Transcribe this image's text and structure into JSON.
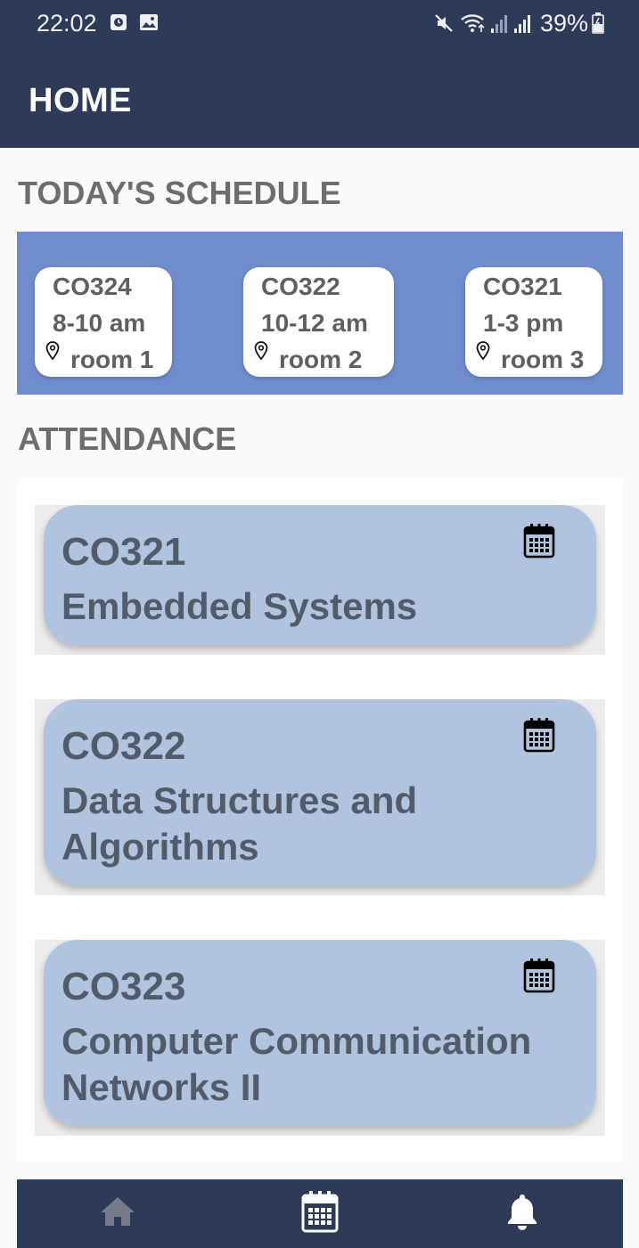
{
  "status_bar": {
    "time": "22:02",
    "battery": "39%",
    "icons": [
      "alarm-icon",
      "image-icon",
      "mute-icon",
      "wifi-icon",
      "signal-icon",
      "signal-icon",
      "battery-icon"
    ]
  },
  "header": {
    "title": "HOME"
  },
  "schedule": {
    "title": "TODAY'S SCHEDULE",
    "items": [
      {
        "code": "CO324",
        "time": "8-10 am",
        "room": "room 1"
      },
      {
        "code": "CO322",
        "time": "10-12 am",
        "room": "room 2"
      },
      {
        "code": "CO321",
        "time": "1-3 pm",
        "room": "room 3"
      }
    ]
  },
  "attendance": {
    "title": "ATTENDANCE",
    "courses": [
      {
        "code": "CO321",
        "name": "Embedded Systems"
      },
      {
        "code": "CO322",
        "name": "Data Structures and Algorithms"
      },
      {
        "code": "CO323",
        "name": "Computer Communication Networks II"
      }
    ]
  },
  "nav": {
    "items": [
      {
        "icon": "home-icon",
        "active": false
      },
      {
        "icon": "calendar-icon",
        "active": true
      },
      {
        "icon": "bell-icon",
        "active": true
      }
    ]
  },
  "colors": {
    "appbar": "#2d3a58",
    "schedule_band": "#6f8ccc",
    "course_card": "#b0c4df"
  }
}
